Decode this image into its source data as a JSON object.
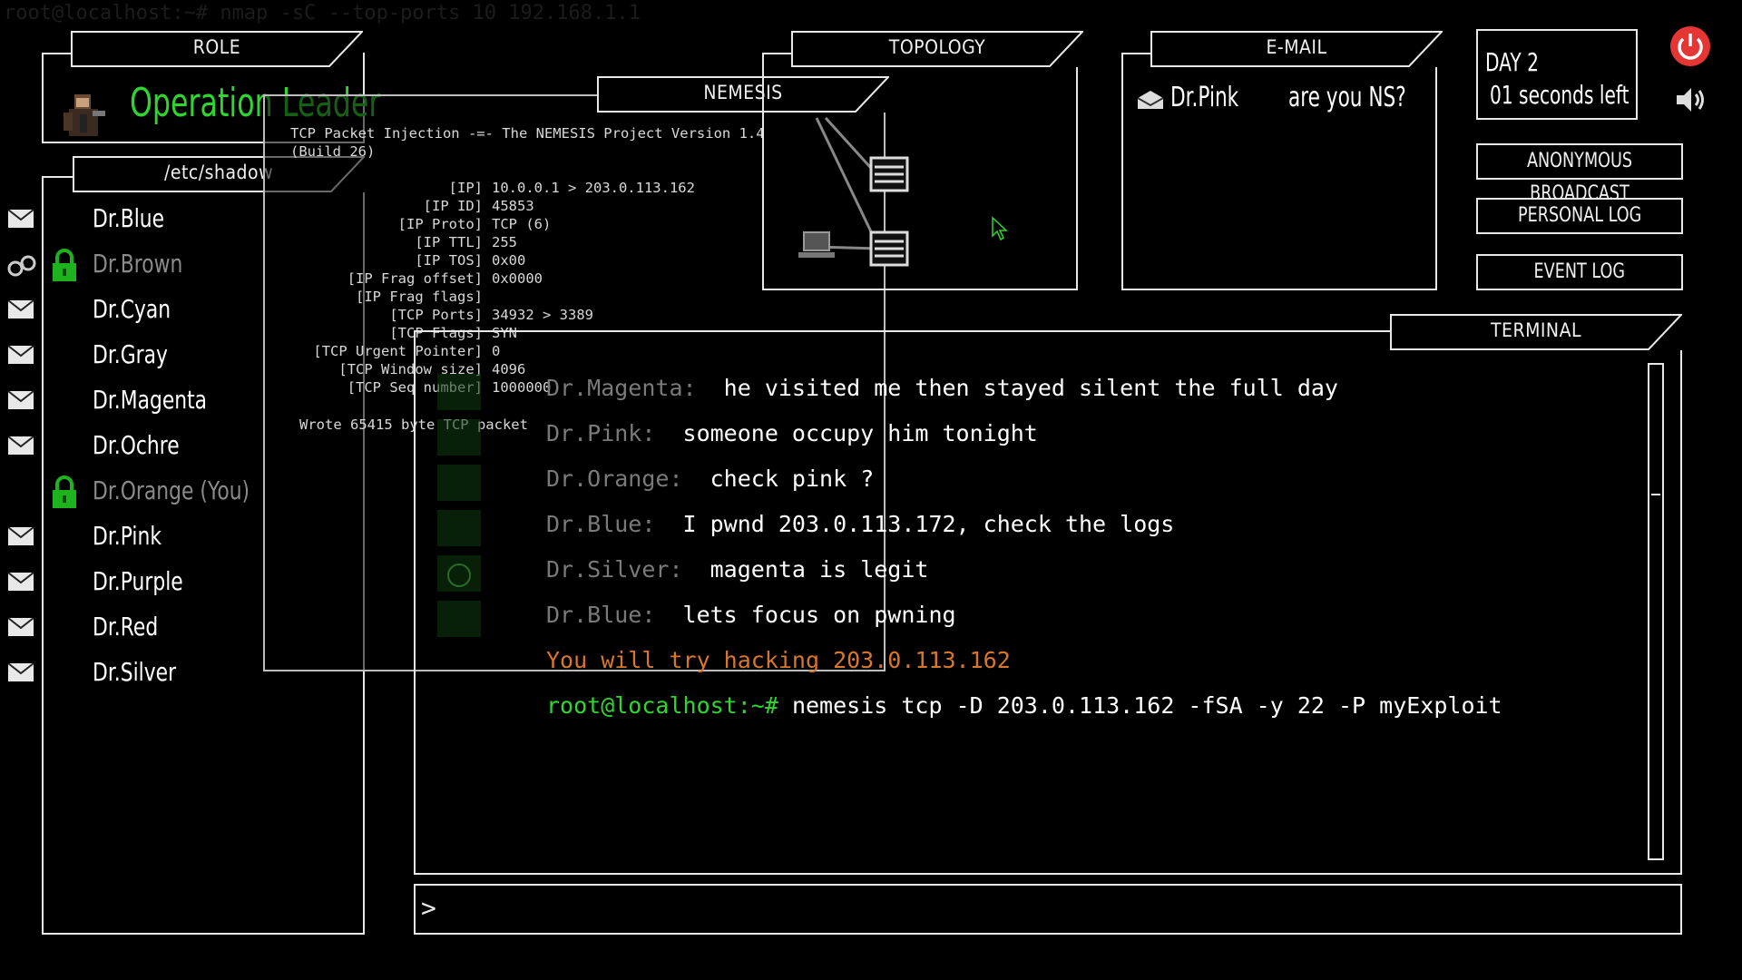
{
  "ghost_command": "root@localhost:~# nmap -sC --top-ports 10 192.168.1.1",
  "role": {
    "tab": "ROLE",
    "title_part1": "Operation ",
    "title_part2": "Leader"
  },
  "shadow": {
    "tab": "/etc/shadow",
    "users": [
      {
        "name": "Dr.Blue",
        "icon": "mail-icon",
        "locked": false,
        "dim": false
      },
      {
        "name": "Dr.Brown",
        "icon": "handcuffs-icon",
        "locked": true,
        "dim": true
      },
      {
        "name": "Dr.Cyan",
        "icon": "mail-icon",
        "locked": false,
        "dim": false
      },
      {
        "name": "Dr.Gray",
        "icon": "mail-icon",
        "locked": false,
        "dim": false
      },
      {
        "name": "Dr.Magenta",
        "icon": "mail-icon",
        "locked": false,
        "dim": false
      },
      {
        "name": "Dr.Ochre",
        "icon": "mail-icon",
        "locked": false,
        "dim": false
      },
      {
        "name": "Dr.Orange (You)",
        "icon": "none",
        "locked": true,
        "dim": true
      },
      {
        "name": "Dr.Pink",
        "icon": "mail-icon",
        "locked": false,
        "dim": false
      },
      {
        "name": "Dr.Purple",
        "icon": "mail-icon",
        "locked": false,
        "dim": false
      },
      {
        "name": "Dr.Red",
        "icon": "mail-icon",
        "locked": false,
        "dim": false
      },
      {
        "name": "Dr.Silver",
        "icon": "mail-icon",
        "locked": false,
        "dim": false
      }
    ]
  },
  "nemesis": {
    "tab": "NEMESIS",
    "header1": "TCP Packet Injection -=- The NEMESIS Project Version 1.4",
    "header2": "(Build 26)",
    "fields": [
      {
        "k": "[IP]",
        "v": "10.0.0.1 > 203.0.113.162"
      },
      {
        "k": "[IP ID]",
        "v": "45853"
      },
      {
        "k": "[IP Proto]",
        "v": "TCP (6)"
      },
      {
        "k": "[IP TTL]",
        "v": "255"
      },
      {
        "k": "[IP TOS]",
        "v": "0x00"
      },
      {
        "k": "[IP Frag offset]",
        "v": "0x0000"
      },
      {
        "k": "[IP Frag flags]",
        "v": ""
      },
      {
        "k": "[TCP Ports]",
        "v": "34932 > 3389"
      },
      {
        "k": "[TCP Flags]",
        "v": "SYN"
      },
      {
        "k": "[TCP Urgent Pointer]",
        "v": "0"
      },
      {
        "k": "[TCP Window size]",
        "v": "4096"
      },
      {
        "k": "[TCP Seq number]",
        "v": "1000000"
      }
    ],
    "footer": "Wrote 65415 byte TCP packet"
  },
  "topology": {
    "tab": "TOPOLOGY"
  },
  "email": {
    "tab": "E-MAIL",
    "sender": "Dr.Pink",
    "subject": "are you NS?"
  },
  "status": {
    "day": "DAY 2",
    "timer": "01 seconds left"
  },
  "buttons": {
    "anonymous_broadcast": "ANONYMOUS BROADCAST",
    "personal_log": "PERSONAL LOG",
    "event_log": "EVENT LOG"
  },
  "terminal": {
    "tab": "TERMINAL",
    "lines": [
      {
        "who": "Dr.Magenta:  ",
        "msg": "he visited me then stayed silent the full day"
      },
      {
        "who": "Dr.Pink:  ",
        "msg": "someone occupy him tonight"
      },
      {
        "who": "Dr.Orange:  ",
        "msg": "check pink ?"
      },
      {
        "who": "Dr.Blue:  ",
        "msg": "I pwnd 203.0.113.172, check the logs"
      },
      {
        "who": "Dr.Silver:  ",
        "msg": "magenta is legit"
      },
      {
        "who": "Dr.Blue:  ",
        "msg": "lets focus on pwning"
      }
    ],
    "system_line": "You will try hacking 203.0.113.162",
    "prompt": "root@localhost:~# ",
    "command": "nemesis tcp -D 203.0.113.162 -fSA -y 22 -P myExploit",
    "input_prompt": ">",
    "input_value": ""
  },
  "colors": {
    "green": "#2fd62f",
    "orange": "#d8772a",
    "power": "#e53535",
    "dim_gray": "#7a7a7a"
  },
  "icons": [
    "power-icon",
    "speaker-icon",
    "mail-icon",
    "handcuffs-icon",
    "lock-icon",
    "avatar",
    "server-icon",
    "laptop-icon",
    "cursor-icon"
  ]
}
